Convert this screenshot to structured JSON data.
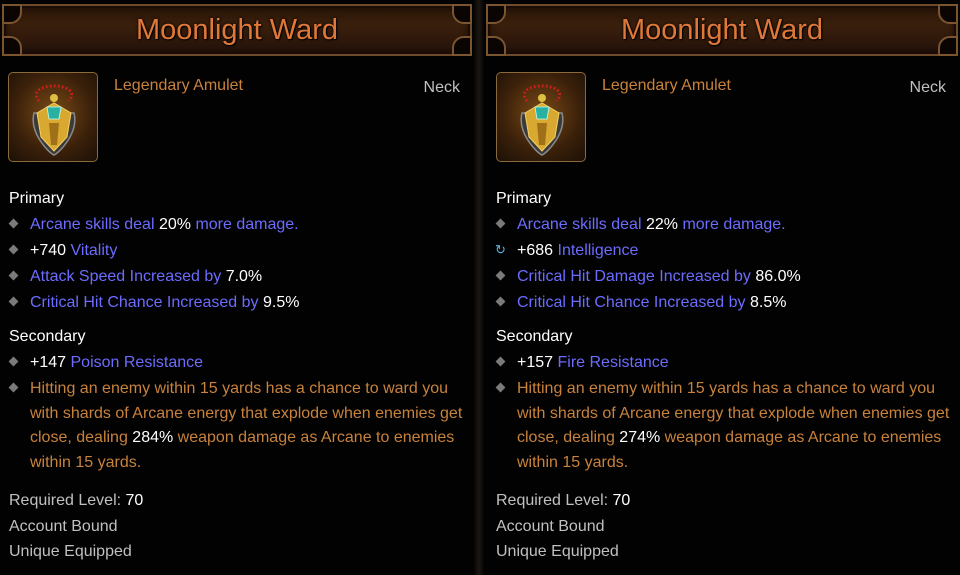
{
  "items": [
    {
      "title": "Moonlight Ward",
      "type": "Legendary Amulet",
      "slot": "Neck",
      "primary_label": "Primary",
      "primary": [
        {
          "bullet": "diamond-icon",
          "a": "Arcane skills deal",
          "b": "20%",
          "c": "more damage."
        },
        {
          "bullet": "diamond-icon",
          "a": "+740",
          "b": "Vitality"
        },
        {
          "bullet": "diamond-icon",
          "a": "Attack Speed Increased by",
          "b": "7.0%"
        },
        {
          "bullet": "diamond-icon",
          "a": "Critical Hit Chance Increased by",
          "b": "9.5%"
        }
      ],
      "secondary_label": "Secondary",
      "secondary": [
        {
          "a": "+147",
          "b": "Poison Resistance"
        }
      ],
      "legendary": {
        "before": "Hitting an enemy within 15 yards has a chance to ward you with shards of Arcane energy that explode when enemies get close, dealing",
        "value": "284%",
        "after": "weapon damage as Arcane to enemies within 15 yards."
      },
      "required_level_label": "Required Level:",
      "required_level": "70",
      "account_bound": "Account Bound",
      "unique_equipped": "Unique Equipped"
    },
    {
      "title": "Moonlight Ward",
      "type": "Legendary Amulet",
      "slot": "Neck",
      "primary_label": "Primary",
      "primary": [
        {
          "bullet": "diamond-icon",
          "a": "Arcane skills deal",
          "b": "22%",
          "c": "more damage."
        },
        {
          "bullet": "reroll-icon",
          "a": "+686",
          "b": "Intelligence"
        },
        {
          "bullet": "diamond-icon",
          "a": "Critical Hit Damage Increased by",
          "b": "86.0%"
        },
        {
          "bullet": "diamond-icon",
          "a": "Critical Hit Chance Increased by",
          "b": "8.5%"
        }
      ],
      "secondary_label": "Secondary",
      "secondary": [
        {
          "a": "+157",
          "b": "Fire Resistance"
        }
      ],
      "legendary": {
        "before": "Hitting an enemy within 15 yards has a chance to ward you with shards of Arcane energy that explode when enemies get close, dealing",
        "value": "274%",
        "after": "weapon damage as Arcane to enemies within 15 yards."
      },
      "required_level_label": "Required Level:",
      "required_level": "70",
      "account_bound": "Account Bound",
      "unique_equipped": "Unique Equipped"
    }
  ],
  "colors": {
    "title": "#e0783a",
    "magic_blue": "#6c6cff",
    "legendary_orange": "#c8823c",
    "gray": "#c0c0c0",
    "reroll": "#5ab4e6"
  }
}
